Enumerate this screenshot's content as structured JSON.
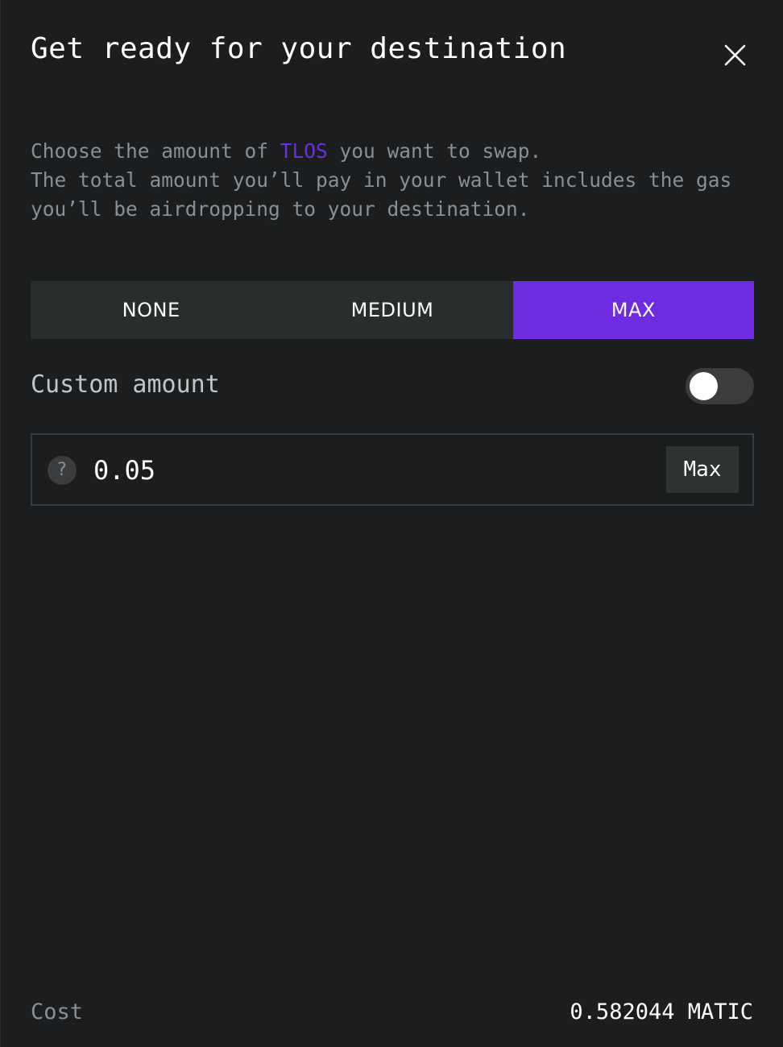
{
  "dialog": {
    "title": "Get ready for your destination",
    "close_icon": "close-icon"
  },
  "description": {
    "line1_prefix": "Choose the amount of ",
    "token": "TLOS",
    "line1_suffix": " you want to swap.",
    "line2": "The total amount you’ll pay in your wallet includes the gas you’ll be airdropping to your destination.",
    "token_color": "#6d2ce0"
  },
  "amount_options": [
    {
      "label": "NONE",
      "selected": false
    },
    {
      "label": "MEDIUM",
      "selected": false
    },
    {
      "label": "MAX",
      "selected": true
    }
  ],
  "custom_amount": {
    "label": "Custom amount",
    "toggle_on": false
  },
  "amount_field": {
    "help_icon": "question-mark-icon",
    "help_glyph": "?",
    "value": "0.05",
    "max_label": "Max"
  },
  "cost": {
    "label": "Cost",
    "value": "0.582044 MATIC"
  },
  "colors": {
    "background": "#1b1d1e",
    "accent": "#6d2ce0",
    "segment_bg": "#2a2d2e",
    "muted_text": "#8b8f92"
  }
}
